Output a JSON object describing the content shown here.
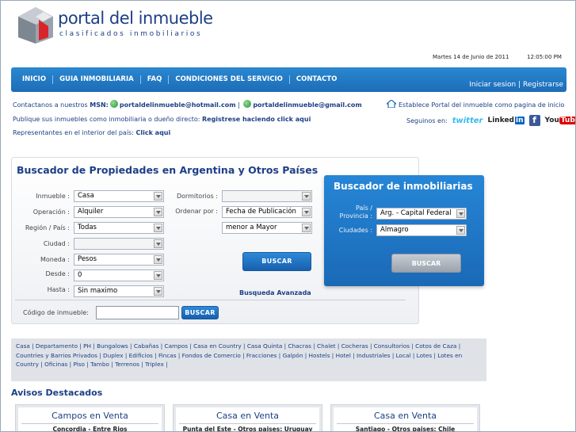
{
  "header": {
    "logo_title": "portal del inmueble",
    "logo_subtitle": "clasificados inmobiliarios",
    "date": "Martes 14 de Junio de 2011",
    "time": "12:05:00 PM"
  },
  "nav": {
    "items": [
      "INICIO",
      "GUIA INMOBILIARIA",
      "FAQ",
      "CONDICIONES DEL SERVICIO",
      "CONTACTO"
    ],
    "login": "Iniciar sesion",
    "register": "Registrarse"
  },
  "info": {
    "msn_prefix": "Contactanos a nuestros",
    "msn_label": "MSN:",
    "msn_email_1": "portaldelinmueble@hotmail.com",
    "msn_email_2": "portaldelinmueble@gmail.com",
    "homepage": "Establece Portal del inmueble como pagina de inicio",
    "publish_text": "Publique sus inmuebles como inmobiliaria o dueño directo:",
    "publish_link": "Registrese haciendo click aqui",
    "reps_text": "Representantes en el interior del país:",
    "reps_link": "Click aqui",
    "follow": "Seguinos en:",
    "twitter": "twitter",
    "linkedin": "Linked",
    "linkedin_in": "in",
    "facebook": "f",
    "youtube": "You",
    "youtube_tube": "Tube"
  },
  "search": {
    "title": "Buscador de Propiedades en Argentina y Otros Países",
    "inmueble_label": "Inmueble :",
    "inmueble_value": "Casa",
    "operacion_label": "Operación :",
    "operacion_value": "Alquiler",
    "region_label": "Región / País :",
    "region_value": "Todas",
    "ciudad_label": "Ciudad :",
    "ciudad_value": "",
    "moneda_label": "Moneda :",
    "moneda_value": "Pesos",
    "desde_label": "Desde :",
    "desde_value": "0",
    "hasta_label": "Hasta :",
    "hasta_value": "Sin maximo",
    "dormitorios_label": "Dormitorios :",
    "dormitorios_value": "",
    "ordenar_label": "Ordenar por :",
    "ordenar_value": "Fecha de Publicación",
    "orden_value": "menor a Mayor",
    "buscar_label": "BUSCAR",
    "advanced": "Busqueda Avanzada",
    "code_label": "Código de inmueble:",
    "code_value": "",
    "code_buscar": "BUSCAR"
  },
  "inmobiliarias": {
    "title": "Buscador de inmobiliarias",
    "pais_label_1": "País /",
    "pais_label_2": "Provincia :",
    "pais_value": "Arg. - Capital Federal",
    "ciudades_label": "Ciudades :",
    "ciudades_value": "Almagro",
    "buscar_label": "BUSCAR"
  },
  "categories": "Casa | Departamento | PH | Bungalows | Cabañas | Campos | Casa en Country | Casa Quinta | Chacras | Chalet | Cocheras | Consultorios | Cotos de Caza | Countries y Barrios Privados | Duplex | Edificios | Fincas | Fondos de Comercio | Fracciones | Galpón | Hostels | Hotel | Industriales | Local | Lotes | Lotes en Country | Oficinas | Piso | Tambo | Terrenos | Triplex |",
  "destacados": {
    "title": "Avisos Destacados",
    "cards": [
      {
        "title": "Campos en Venta",
        "sub": "Concordia - Entre Rios"
      },
      {
        "title": "Casa en Venta",
        "sub": "Punta del Este - Otros paises: Uruguay"
      },
      {
        "title": "Casa en Venta",
        "sub": "Santiago - Otros paises: Chile"
      }
    ]
  },
  "colors": {
    "brand_blue": "#1d3f86",
    "nav_blue": "#2a87d0",
    "panel_blue": "#2686d6"
  }
}
